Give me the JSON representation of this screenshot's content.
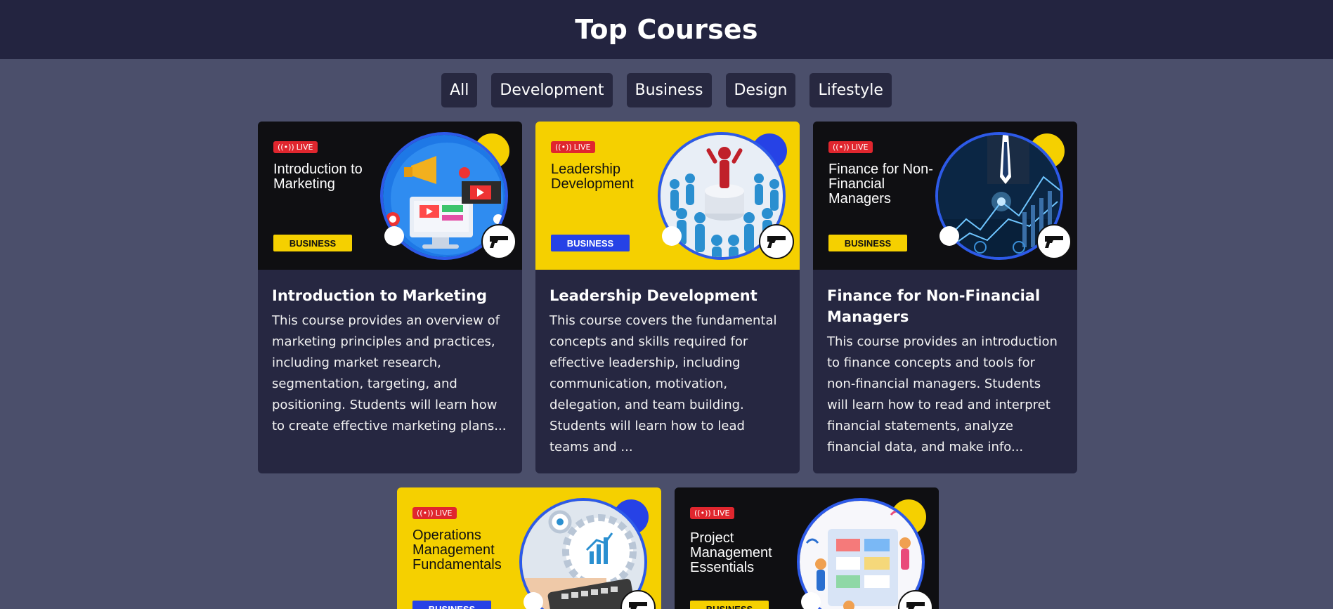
{
  "header": {
    "title": "Top Courses"
  },
  "filters": [
    {
      "label": "All"
    },
    {
      "label": "Development"
    },
    {
      "label": "Business"
    },
    {
      "label": "Design"
    },
    {
      "label": "Lifestyle"
    }
  ],
  "courses": [
    {
      "banner_title": "Introduction to Marketing",
      "live_label": "LIVE",
      "category_label": "BUSINESS",
      "title": "Introduction to Marketing",
      "description": "This course provides an overview of marketing principles and practices, including market research, segmentation, targeting, and positioning. Students will learn how to create effective marketing plans...",
      "theme": "dark"
    },
    {
      "banner_title": "Leadership Development",
      "live_label": "LIVE",
      "category_label": "BUSINESS",
      "title": "Leadership Development",
      "description": "This course covers the fundamental concepts and skills required for effective leadership, including communication, motivation, delegation, and team building. Students will learn how to lead teams and ...",
      "theme": "yellow"
    },
    {
      "banner_title": "Finance for Non-Financial Managers",
      "live_label": "LIVE",
      "category_label": "BUSINESS",
      "title": "Finance for Non-Financial Managers",
      "description": "This course provides an introduction to finance concepts and tools for non-financial managers. Students will learn how to read and interpret financial statements, analyze financial data, and make info...",
      "theme": "dark"
    },
    {
      "banner_title": "Operations Management Fundamentals",
      "live_label": "LIVE",
      "category_label": "BUSINESS",
      "title": "",
      "description": "",
      "theme": "yellow"
    },
    {
      "banner_title": "Project Management Essentials",
      "live_label": "LIVE",
      "category_label": "BUSINESS",
      "title": "",
      "description": "",
      "theme": "dark"
    }
  ],
  "colors": {
    "page_bg": "#4b4f6b",
    "header_bg": "#232440",
    "card_bg": "#262741",
    "accent_yellow": "#f5d000",
    "accent_blue": "#2642e6",
    "live_red": "#e0262e"
  }
}
